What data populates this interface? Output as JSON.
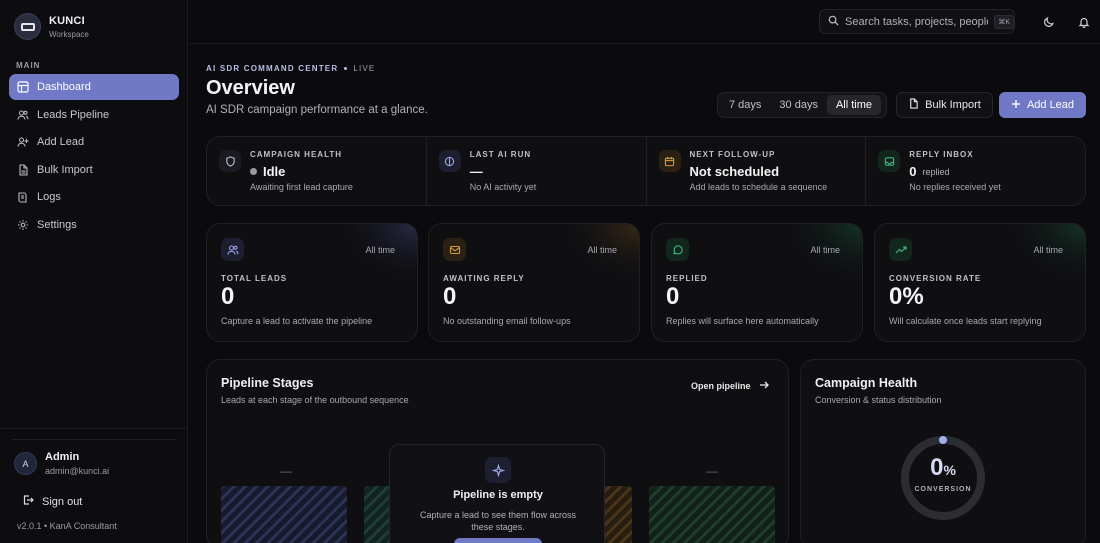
{
  "brand": {
    "name": "KUNCI",
    "subtitle": "Workspace"
  },
  "sidebar": {
    "section_label": "MAIN",
    "items": [
      {
        "label": "Dashboard",
        "icon": "dashboard-icon",
        "active": true
      },
      {
        "label": "Leads Pipeline",
        "icon": "users-icon",
        "active": false
      },
      {
        "label": "Add Lead",
        "icon": "user-plus-icon",
        "active": false
      },
      {
        "label": "Bulk Import",
        "icon": "file-icon",
        "active": false
      },
      {
        "label": "Logs",
        "icon": "book-icon",
        "active": false
      },
      {
        "label": "Settings",
        "icon": "gear-icon",
        "active": false
      }
    ]
  },
  "user": {
    "initial": "A",
    "name": "Admin",
    "email": "admin@kunci.ai"
  },
  "signout_label": "Sign out",
  "version": "v2.0.1 • KanA Consultant",
  "search": {
    "placeholder": "Search tasks, projects, people...",
    "shortcut": "⌘K"
  },
  "header": {
    "eyebrow": "AI SDR COMMAND CENTER",
    "live": "LIVE",
    "title": "Overview",
    "subtitle": "AI SDR campaign performance at a glance."
  },
  "range": {
    "options": [
      "7 days",
      "30 days",
      "All time"
    ],
    "selected": "All time"
  },
  "actions": {
    "bulk_import": "Bulk Import",
    "add_lead": "Add Lead"
  },
  "status": [
    {
      "label": "CAMPAIGN HEALTH",
      "value": "Idle",
      "note": "Awaiting first lead capture",
      "icon": "shield-icon"
    },
    {
      "label": "LAST AI RUN",
      "value": "—",
      "note": "No AI activity yet",
      "icon": "globe-icon"
    },
    {
      "label": "NEXT FOLLOW-UP",
      "value": "Not scheduled",
      "note": "Add leads to schedule a sequence",
      "icon": "calendar-icon"
    },
    {
      "label": "REPLY INBOX",
      "value": "0",
      "value_suffix": "replied",
      "note": "No replies received yet",
      "icon": "inbox-icon"
    }
  ],
  "kpis": [
    {
      "label": "TOTAL LEADS",
      "value": "0",
      "range": "All time",
      "note": "Capture a lead to activate the pipeline",
      "icon": "users-icon"
    },
    {
      "label": "AWAITING REPLY",
      "value": "0",
      "range": "All time",
      "note": "No outstanding email follow-ups",
      "icon": "mail-icon"
    },
    {
      "label": "REPLIED",
      "value": "0",
      "range": "All time",
      "note": "Replies will surface here automatically",
      "icon": "message-icon"
    },
    {
      "label": "CONVERSION RATE",
      "value": "0%",
      "range": "All time",
      "note": "Will calculate once leads start replying",
      "icon": "trend-icon"
    }
  ],
  "pipeline": {
    "title": "Pipeline Stages",
    "subtitle": "Leads at each stage of the outbound sequence",
    "open_link": "Open pipeline",
    "stage_placeholder": "—",
    "empty_title": "Pipeline is empty",
    "empty_text": "Capture a lead to see them flow across these stages."
  },
  "health": {
    "title": "Campaign Health",
    "subtitle": "Conversion & status distribution",
    "value": "0",
    "unit": "%",
    "label": "CONVERSION",
    "conversion_fraction": 0
  },
  "colors": {
    "accent": "#6f79c6",
    "amber": "#c58a2b",
    "green": "#3aa77a",
    "blue": "#7c85d6"
  }
}
